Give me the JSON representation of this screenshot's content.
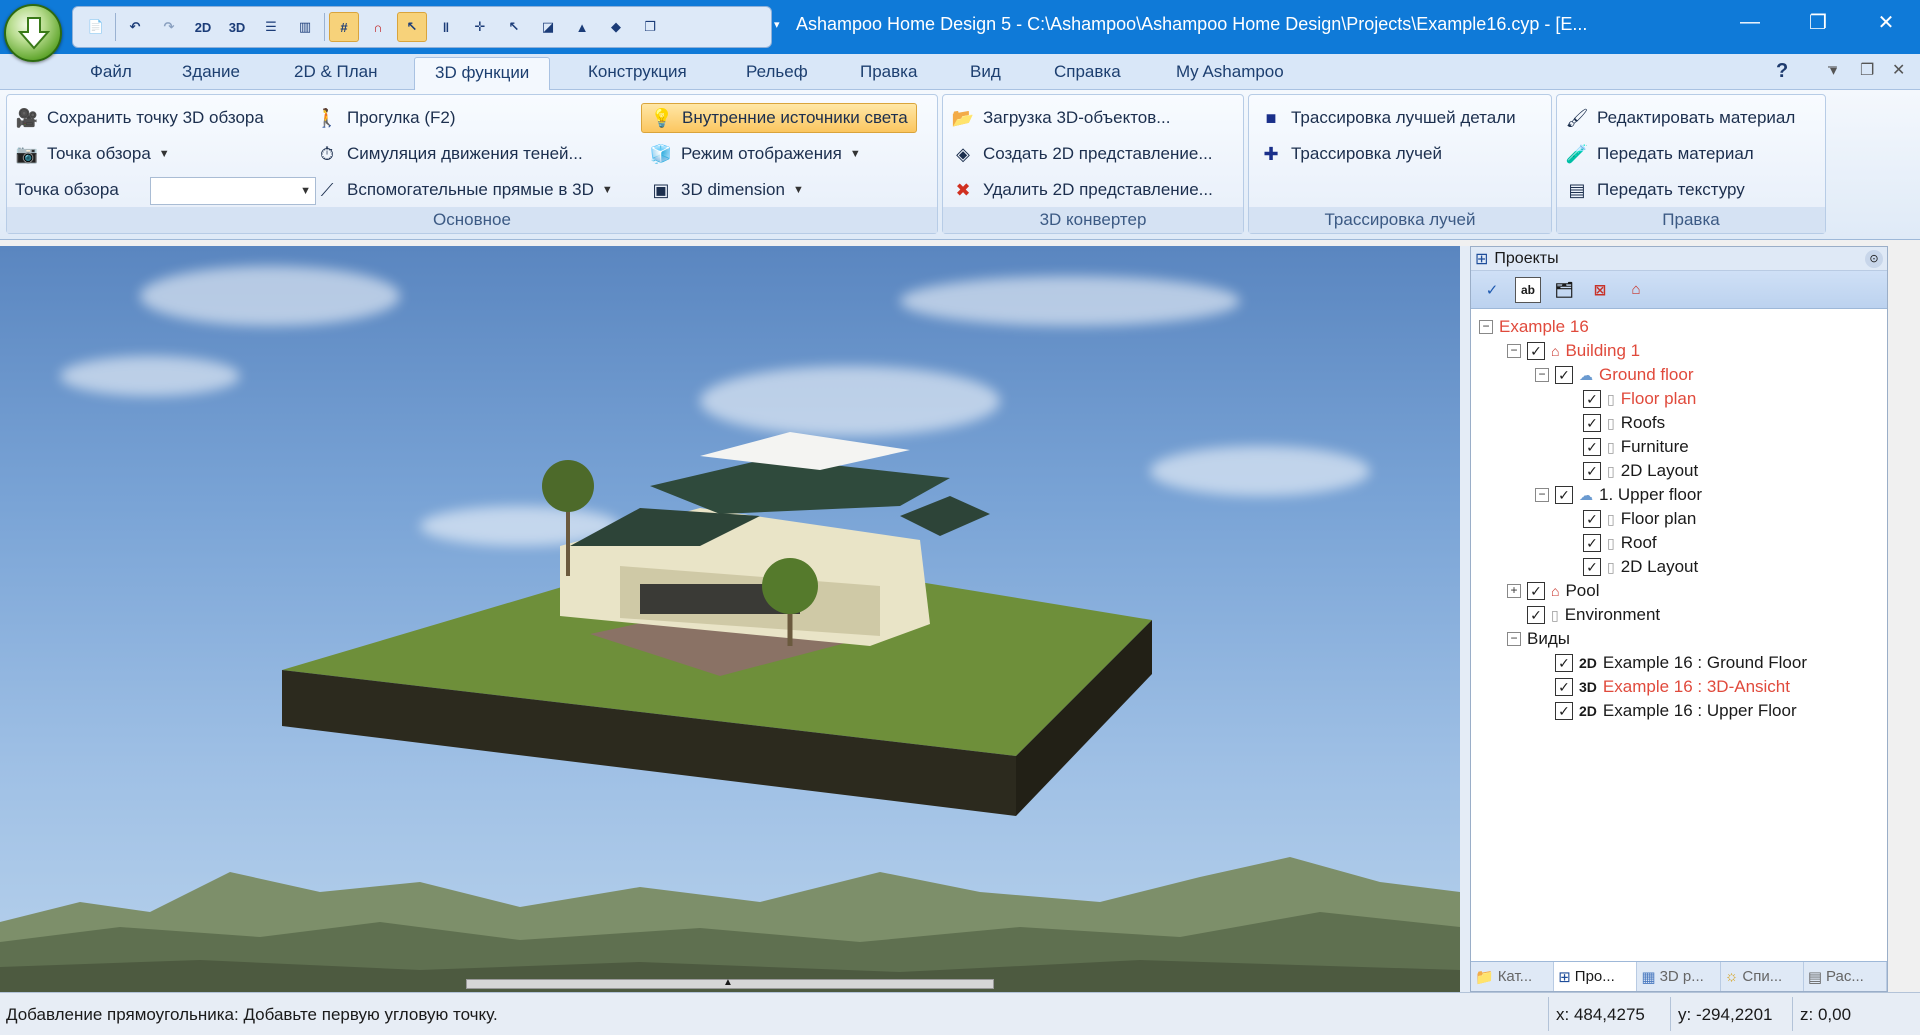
{
  "window": {
    "title": "Ashampoo Home Design 5 - C:\\Ashampoo\\Ashampoo Home Design\\Projects\\Example16.cyp - [E...",
    "controls": [
      "—",
      "❐",
      "✕"
    ]
  },
  "qat": {
    "label_2d": "2D",
    "label_3d": "3D"
  },
  "menu": {
    "tabs": [
      "Файл",
      "Здание",
      "2D & План",
      "3D функции",
      "Конструкция",
      "Рельеф",
      "Правка",
      "Вид",
      "Справка",
      "My Ashampoo"
    ],
    "active": "3D функции"
  },
  "ribbon": {
    "main": {
      "label": "Основное",
      "save_viewpoint": "Сохранить точку 3D обзора",
      "viewpoint": "Точка обзора",
      "viewpoint_combo_label": "Точка обзора",
      "walk": "Прогулка (F2)",
      "shadow_sim": "Симуляция движения теней...",
      "aux_lines": "Вспомогательные прямые в 3D",
      "interior_lights": "Внутренние источники света",
      "display_mode": "Режим отображения",
      "dimension_3d": "3D dimension"
    },
    "converter": {
      "label": "3D конвертер",
      "load_objects": "Загрузка 3D-объектов...",
      "create_2d": "Создать 2D представление...",
      "delete_2d": "Удалить 2D представление..."
    },
    "raytrace": {
      "label": "Трассировка лучей",
      "best_detail": "Трассировка лучшей детали",
      "rays": "Трассировка лучей"
    },
    "edit": {
      "label": "Правка",
      "edit_material": "Редактировать материал",
      "transfer_material": "Передать материал",
      "transfer_texture": "Передать текстуру"
    }
  },
  "panel": {
    "title": "Проекты",
    "tree": [
      {
        "label": "Example 16",
        "level": 0,
        "expander": "−",
        "check": false,
        "icon": "",
        "red": true
      },
      {
        "label": "Building 1",
        "level": 1,
        "expander": "−",
        "check": true,
        "icon": "house-icon",
        "red": true
      },
      {
        "label": "Ground floor",
        "level": 2,
        "expander": "−",
        "check": true,
        "icon": "floor-icon",
        "red": true
      },
      {
        "label": "Floor plan",
        "level": 3,
        "expander": "",
        "check": true,
        "icon": "page-icon",
        "red": true
      },
      {
        "label": "Roofs",
        "level": 3,
        "expander": "",
        "check": true,
        "icon": "page-icon",
        "red": false
      },
      {
        "label": "Furniture",
        "level": 3,
        "expander": "",
        "check": true,
        "icon": "page-icon",
        "red": false
      },
      {
        "label": "2D Layout",
        "level": 3,
        "expander": "",
        "check": true,
        "icon": "page-icon",
        "red": false
      },
      {
        "label": "1. Upper floor",
        "level": 2,
        "expander": "−",
        "check": true,
        "icon": "floor-icon",
        "red": false
      },
      {
        "label": "Floor plan",
        "level": 3,
        "expander": "",
        "check": true,
        "icon": "page-icon",
        "red": false
      },
      {
        "label": "Roof",
        "level": 3,
        "expander": "",
        "check": true,
        "icon": "page-icon",
        "red": false
      },
      {
        "label": "2D Layout",
        "level": 3,
        "expander": "",
        "check": true,
        "icon": "page-icon",
        "red": false
      },
      {
        "label": "Pool",
        "level": 1,
        "expander": "+",
        "check": true,
        "icon": "house-icon",
        "red": false
      },
      {
        "label": "Environment",
        "level": 1,
        "expander": "",
        "check": true,
        "icon": "page-icon",
        "red": false
      },
      {
        "label": "Виды",
        "level": 1,
        "expander": "−",
        "check": false,
        "icon": "",
        "red": false
      },
      {
        "label": "Example 16 : Ground Floor",
        "level": 2,
        "expander": "",
        "check": true,
        "icon": "2D",
        "red": false
      },
      {
        "label": "Example 16 : 3D-Ansicht",
        "level": 2,
        "expander": "",
        "check": true,
        "icon": "3D",
        "red": true
      },
      {
        "label": "Example 16 : Upper Floor",
        "level": 2,
        "expander": "",
        "check": true,
        "icon": "2D",
        "red": false
      }
    ],
    "tabs": [
      "Кат...",
      "Про...",
      "3D р...",
      "Спи...",
      "Рас..."
    ]
  },
  "status": {
    "message": "Добавление прямоугольника: Добавьте первую угловую точку.",
    "x": "x: 484,4275",
    "y": "y: -294,2201",
    "z": "z: 0,00"
  },
  "colors": {
    "titlebar": "#0f7ad8",
    "accent_red": "#e04a3c",
    "highlight": "#fbc660"
  }
}
